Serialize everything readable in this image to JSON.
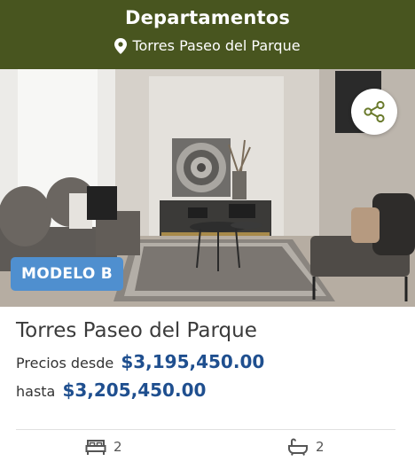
{
  "header": {
    "title": "Departamentos",
    "location": "Torres Paseo del Parque"
  },
  "photo": {
    "badge": "MODELO B"
  },
  "listing": {
    "title": "Torres Paseo del Parque",
    "price_from_label": "Precios desde",
    "price_from": "$3,195,450.00",
    "price_to_label": "hasta",
    "price_to": "$3,205,450.00"
  },
  "features": {
    "bedrooms": "2",
    "bathrooms": "2"
  },
  "icons": {
    "location": "map-pin-icon",
    "share": "share-icon",
    "bed": "bed-icon",
    "bath": "bathtub-icon"
  },
  "colors": {
    "header_bg": "#48551f",
    "badge_bg": "#4f8fcf",
    "price": "#1f4f8f"
  }
}
